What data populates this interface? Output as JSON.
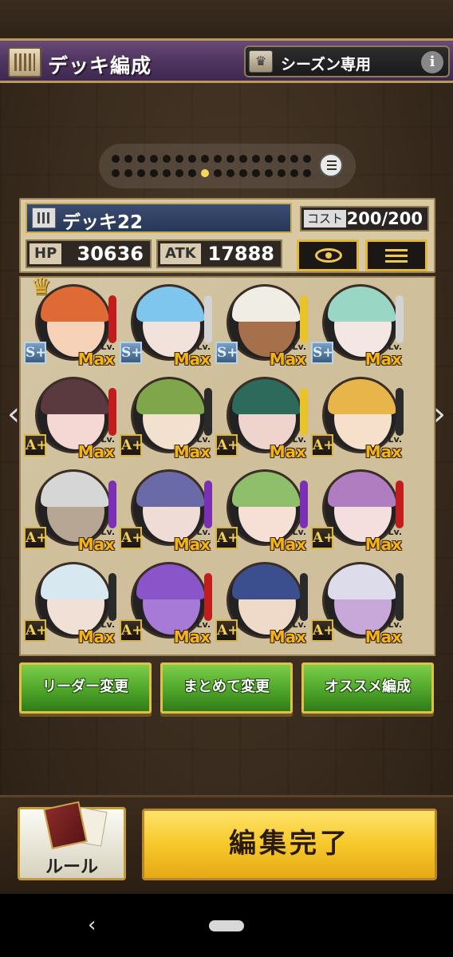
{
  "header": {
    "title": "デッキ編成",
    "season_label": "シーズン専用",
    "info_glyph": "i"
  },
  "pager": {
    "row1_dots": 16,
    "row2_dots": 16,
    "active_row": 2,
    "active_index": 7
  },
  "deck": {
    "name": "デッキ22",
    "cost_label": "コスト",
    "cost_value": "200/200",
    "hp_label": "HP",
    "hp_value": "30636",
    "atk_label": "ATK",
    "atk_value": "17888"
  },
  "cards": [
    {
      "rank": "S+",
      "lv_small": "Lv.",
      "lv": "Max",
      "leader": true,
      "hair": "#e06a35",
      "skin": "#f5d2b8",
      "ring": "#c21d1d"
    },
    {
      "rank": "S+",
      "lv_small": "Lv.",
      "lv": "Max",
      "leader": false,
      "hair": "#7fc6ee",
      "skin": "#f1e2dc",
      "ring": "#d3d3d3"
    },
    {
      "rank": "S+",
      "lv_small": "Lv.",
      "lv": "Max",
      "leader": false,
      "hair": "#f0ede4",
      "skin": "#a6704a",
      "ring": "#e8c32a"
    },
    {
      "rank": "S+",
      "lv_small": "Lv.",
      "lv": "Max",
      "leader": false,
      "hair": "#9ad6c4",
      "skin": "#f3e6e3",
      "ring": "#d3d3d3"
    },
    {
      "rank": "A+",
      "lv_small": "Lv.",
      "lv": "Max",
      "leader": false,
      "hair": "#5b3a3f",
      "skin": "#f5d7d3",
      "ring": "#c21d1d"
    },
    {
      "rank": "A+",
      "lv_small": "Lv.",
      "lv": "Max",
      "leader": false,
      "hair": "#7fa64a",
      "skin": "#f3e1cf",
      "ring": "#2a2a2a"
    },
    {
      "rank": "A+",
      "lv_small": "Lv.",
      "lv": "Max",
      "leader": false,
      "hair": "#2e6a5c",
      "skin": "#eed4cc",
      "ring": "#e8c32a"
    },
    {
      "rank": "A+",
      "lv_small": "Lv.",
      "lv": "Max",
      "leader": false,
      "hair": "#e8b54a",
      "skin": "#f6e0cc",
      "ring": "#2a2a2a"
    },
    {
      "rank": "A+",
      "lv_small": "Lv.",
      "lv": "Max",
      "leader": false,
      "hair": "#d6d6d6",
      "skin": "#b8a694",
      "ring": "#7b2fb5"
    },
    {
      "rank": "A+",
      "lv_small": "Lv.",
      "lv": "Max",
      "leader": false,
      "hair": "#6a6aa8",
      "skin": "#f0dcd6",
      "ring": "#7b2fb5"
    },
    {
      "rank": "A+",
      "lv_small": "Lv.",
      "lv": "Max",
      "leader": false,
      "hair": "#8fbf6a",
      "skin": "#f6dfd4",
      "ring": "#7b2fb5"
    },
    {
      "rank": "A+",
      "lv_small": "Lv.",
      "lv": "Max",
      "leader": false,
      "hair": "#b07ec0",
      "skin": "#f4dede",
      "ring": "#c21d1d"
    },
    {
      "rank": "A+",
      "lv_small": "Lv.",
      "lv": "Max",
      "leader": false,
      "hair": "#d8e8f0",
      "skin": "#f0e0d6",
      "ring": "#2a2a2a"
    },
    {
      "rank": "A+",
      "lv_small": "Lv.",
      "lv": "Max",
      "leader": false,
      "hair": "#8a55c8",
      "skin": "#a77ad8",
      "ring": "#c21d1d"
    },
    {
      "rank": "A+",
      "lv_small": "Lv.",
      "lv": "Max",
      "leader": false,
      "hair": "#3b4f8f",
      "skin": "#efd9c9",
      "ring": "#2a2a2a"
    },
    {
      "rank": "A+",
      "lv_small": "Lv.",
      "lv": "Max",
      "leader": false,
      "hair": "#dcdcea",
      "skin": "#c8a8d8",
      "ring": "#2a2a2a"
    }
  ],
  "actions": {
    "leader_change": "リーダー変更",
    "bulk_change": "まとめて変更",
    "recommended": "オススメ編成"
  },
  "bottom": {
    "rule_label": "ルール",
    "done_label": "編集完了"
  },
  "colors": {
    "header_purple": "#4f3560",
    "gold": "#e2b83a",
    "green_button": "#4ea52a",
    "done_yellow": "#f6c82a"
  }
}
